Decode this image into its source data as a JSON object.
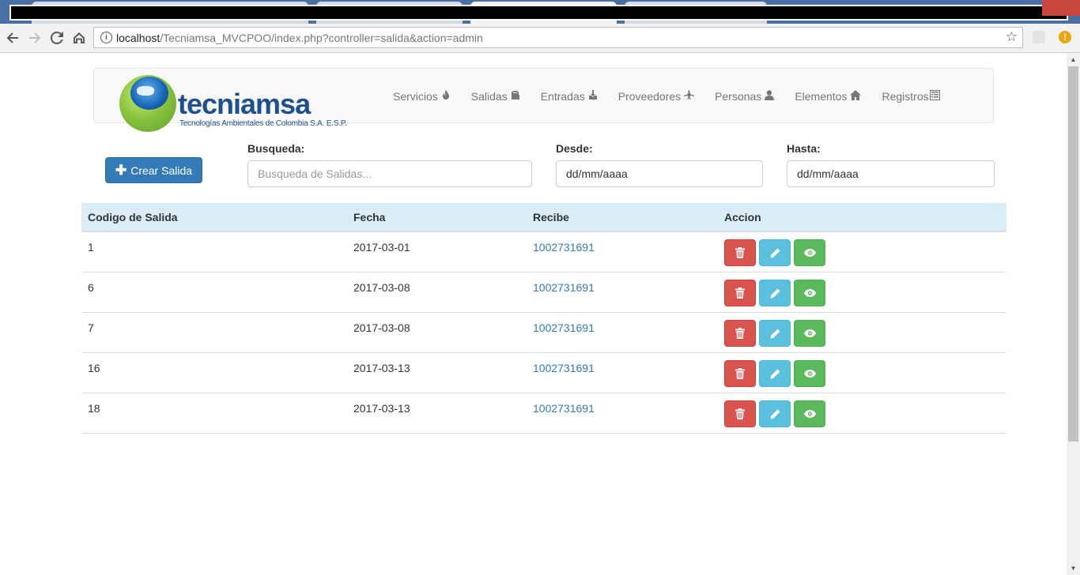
{
  "browser": {
    "url_host": "localhost",
    "url_path": "/Tecniamsa_MVCPOO/index.php?controller=salida&action=admin",
    "info_glyph": "i",
    "alert_glyph": "!"
  },
  "brand": {
    "name": "tecniamsa",
    "tagline": "Tecnologías Ambientales de Colombia S.A. E.S.P."
  },
  "nav": {
    "items": [
      {
        "label": "Servicios",
        "icon": "fire-icon"
      },
      {
        "label": "Salidas",
        "icon": "paste-icon"
      },
      {
        "label": "Entradas",
        "icon": "import-icon"
      },
      {
        "label": "Proveedores",
        "icon": "plane-icon"
      },
      {
        "label": "Personas",
        "icon": "user-icon"
      },
      {
        "label": "Elementos",
        "icon": "home-icon"
      },
      {
        "label": "Registros",
        "icon": "list-alt-icon"
      }
    ]
  },
  "filters": {
    "create_label": "Crear Salida",
    "search_label": "Busqueda:",
    "search_placeholder": "Busqueda de Salidas...",
    "from_label": "Desde:",
    "from_value": "dd/mm/aaaa",
    "to_label": "Hasta:",
    "to_value": "dd/mm/aaaa"
  },
  "table": {
    "headers": [
      "Codigo de Salida",
      "Fecha",
      "Recibe",
      "Accion"
    ],
    "rows": [
      {
        "code": "1",
        "date": "2017-03-01",
        "receiver": "1002731691"
      },
      {
        "code": "6",
        "date": "2017-03-08",
        "receiver": "1002731691"
      },
      {
        "code": "7",
        "date": "2017-03-08",
        "receiver": "1002731691"
      },
      {
        "code": "16",
        "date": "2017-03-13",
        "receiver": "1002731691"
      },
      {
        "code": "18",
        "date": "2017-03-13",
        "receiver": "1002731691"
      }
    ]
  },
  "colors": {
    "primary": "#337ab7",
    "danger": "#d9534f",
    "info": "#5bc0de",
    "success": "#5cb85c",
    "table_header": "#d9edf7",
    "brand_blue": "#1d4f91"
  }
}
